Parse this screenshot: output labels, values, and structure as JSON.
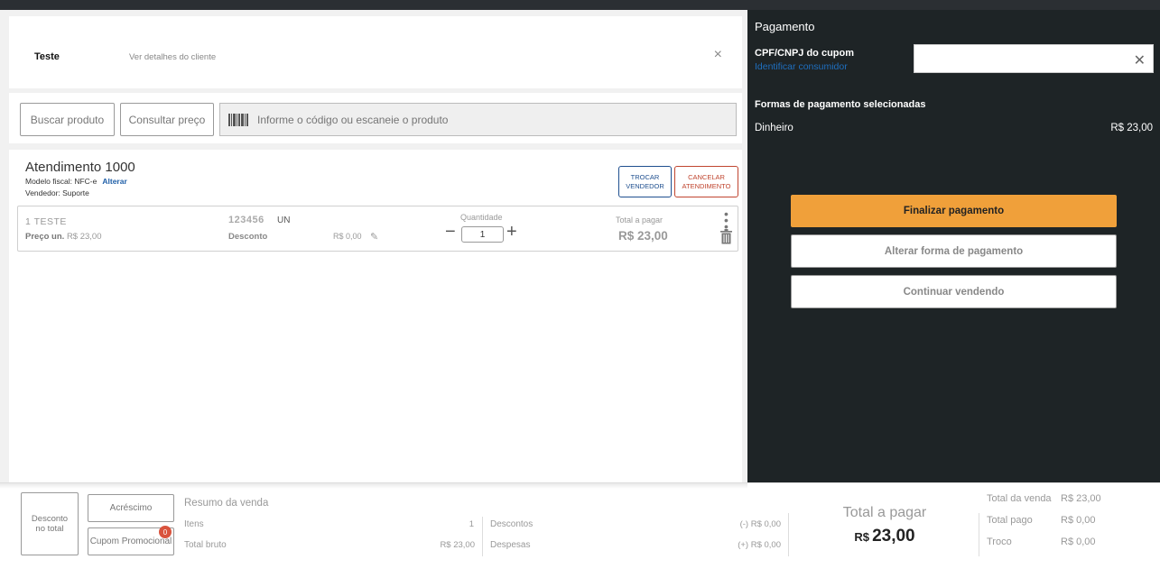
{
  "customer": {
    "name": "Teste",
    "details_link": "Ver detalhes do cliente",
    "close_glyph": "×"
  },
  "search": {
    "buscar_label": "Buscar produto",
    "consultar_label": "Consultar preço",
    "barcode_placeholder": "Informe o código ou escaneie o produto"
  },
  "atendimento": {
    "title": "Atendimento 1000",
    "modelo_label": "Modelo fiscal: NFC-e",
    "alterar_label": "Alterar",
    "vendedor_label": "Vendedor: Suporte",
    "trocar_line1": "TROCAR",
    "trocar_line2": "VENDEDOR",
    "cancelar_line1": "CANCELAR",
    "cancelar_line2": "ATENDIMENTO"
  },
  "item": {
    "name": "1 TESTE",
    "price_label": "Preço un.",
    "price_value": "R$ 23,00",
    "code": "123456",
    "unit": "UN",
    "desconto_label": "Desconto",
    "desconto_value": "R$ 0,00",
    "quantidade_label": "Quantidade",
    "quantidade_value": "1",
    "total_label": "Total a pagar",
    "total_value": "R$ 23,00"
  },
  "pagamento": {
    "title": "Pagamento",
    "cpf_label": "CPF/CNPJ do cupom",
    "identificar_label": "Identificar consumidor",
    "clear_glyph": "✕",
    "formas_title": "Formas de pagamento selecionadas",
    "forma_name": "Dinheiro",
    "forma_value": "R$ 23,00",
    "finalizar_label": "Finalizar pagamento",
    "alterar_label": "Alterar forma de pagamento",
    "continuar_label": "Continuar vendendo"
  },
  "bottom": {
    "desconto_line1": "Desconto",
    "desconto_line2": "no total",
    "acrescimo_label": "Acréscimo",
    "cupom_label": "Cupom Promocional",
    "cupom_badge": "0",
    "resumo_title": "Resumo da venda",
    "itens_label": "Itens",
    "itens_value": "1",
    "bruto_label": "Total bruto",
    "bruto_value": "R$ 23,00",
    "descontos_label": "Descontos",
    "descontos_value": "(-) R$ 0,00",
    "despesas_label": "Despesas",
    "despesas_value": "(+) R$ 0,00",
    "total_pagar_label": "Total a pagar",
    "total_pagar_currency": "R$",
    "total_pagar_value": "23,00",
    "total_venda_label": "Total da venda",
    "total_venda_value": "R$ 23,00",
    "total_pago_label": "Total pago",
    "total_pago_value": "R$ 0,00",
    "troco_label": "Troco",
    "troco_value": "R$ 0,00"
  },
  "colors": {
    "accent_orange": "#f0a03a",
    "panel_dark": "#1e2426",
    "link_blue": "#1f5fa8",
    "cancel_red": "#c0452f"
  }
}
